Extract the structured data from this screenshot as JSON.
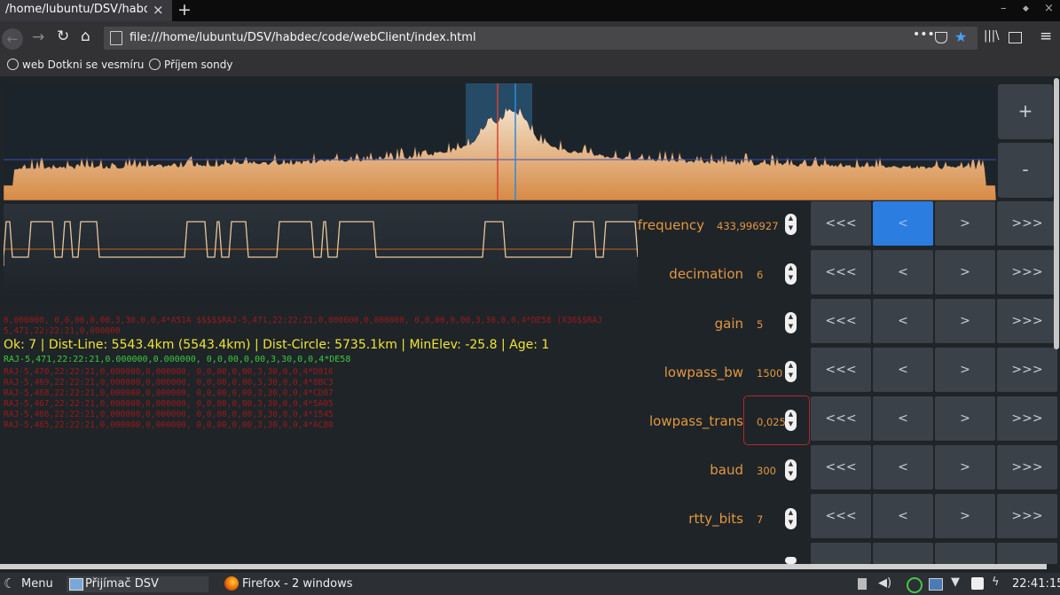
{
  "browser": {
    "tab_title": "/home/lubuntu/DSV/habdec",
    "tab_close": "×",
    "new_tab": "+",
    "window_min": "–",
    "window_max": "◆",
    "window_close": "×",
    "url": "file:///home/lubuntu/DSV/habdec/code/webClient/index.html",
    "bookmarks": [
      {
        "label": "web Dotkni se vesmíru"
      },
      {
        "label": "Příjem sondy"
      }
    ]
  },
  "spectrum": {
    "zoom_in": "+",
    "zoom_out": "-"
  },
  "log": {
    "red_lines_top": [
      "0,000000, 0,0,00,0,00,3,30,0,0,4*A51A $$$$$RAJ-5,471,22:22:21,0,000000,0,000000, 0,0,00,0,00,3,30,0,0,4*DE58 (X36$$RAJ",
      "5,471,22:22:21,0,000000"
    ],
    "status": "Ok: 7 | Dist-Line: 5543.4km (5543.4km) | Dist-Circle: 5735.1km | MinElev: -25.8 | Age: 1",
    "green_line": "RAJ-5,471,22:22:21,0.000000,0.000000, 0,0,00,0,00,3,30,0,0,4*DE58",
    "red_lines_bottom": [
      "RAJ-5,470,22:22:21,0,000000,0,000000, 0,0,00,0,00,3,30,0,0,4*D016",
      "RAJ-5,469,22:22:21,0,000000,0,000000, 0,0,00,0,00,3,30,0,0,4*8BC3",
      "RAJ-5,468,22:22:21,0,000000,0,000000, 0,0,00,0,00,3,30,0,0,4*CD87",
      "RAJ-5,467,22:22:21,0,000000,0,000000, 0,0,00,0,00,3,30,0,0,4*5A05",
      "RAJ-5,466,22:22:21,0,000000,0,000000, 0,0,00,0,00,3,30,0,0,4*1545",
      "RAJ-5,465,22:22:21,0,000000,0,000000, 0,0,00,0,00,3,30,0,0,4*AC80"
    ]
  },
  "params": [
    {
      "label": "frequency",
      "value": "433,996927"
    },
    {
      "label": "decimation",
      "value": "6"
    },
    {
      "label": "gain",
      "value": "5"
    },
    {
      "label": "lowpass_bw",
      "value": "1500"
    },
    {
      "label": "lowpass_trans",
      "value": "0,025"
    },
    {
      "label": "baud",
      "value": "300"
    },
    {
      "label": "rtty_bits",
      "value": "7"
    }
  ],
  "step_buttons": [
    "<<<",
    "<",
    ">",
    ">>>"
  ],
  "taskbar": {
    "menu": "Menu",
    "app1": "Přijímač DSV",
    "app2": "Firefox - 2 windows",
    "clock": "22:41:15"
  }
}
